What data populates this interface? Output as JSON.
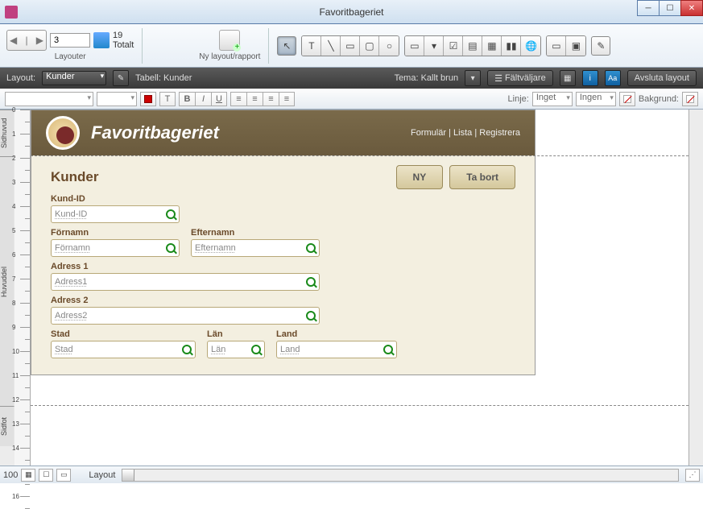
{
  "window": {
    "title": "Favoritbageriet"
  },
  "toolbar": {
    "current_record": "3",
    "total_count": "19",
    "total_label": "Totalt",
    "layouter_label": "Layouter",
    "new_layout_label": "Ny layout/rapport"
  },
  "darkbar": {
    "layout_label": "Layout:",
    "layout_value": "Kunder",
    "table_label": "Tabell:",
    "table_value": "Kunder",
    "tema_label": "Tema:",
    "tema_value": "Kallt brun",
    "faltvaljare": "Fältväljare",
    "exit": "Avsluta layout"
  },
  "fmtbar": {
    "linje_label": "Linje:",
    "linje_value": "Inget",
    "linje_style": "Ingen",
    "bakgrund_label": "Bakgrund:"
  },
  "ruler_unit": "cm",
  "form": {
    "title": "Favoritbageriet",
    "nav": {
      "formular": "Formulär",
      "lista": "Lista",
      "registrera": "Registrera"
    },
    "section": "Kunder",
    "btn_new": "NY",
    "btn_delete": "Ta bort",
    "fields": {
      "kundid": {
        "label": "Kund-ID",
        "ph": "Kund-ID"
      },
      "fornamn": {
        "label": "Förnamn",
        "ph": "Förnamn"
      },
      "efternamn": {
        "label": "Efternamn",
        "ph": "Efternamn"
      },
      "adress1": {
        "label": "Adress 1",
        "ph": "Adress1"
      },
      "adress2": {
        "label": "Adress 2",
        "ph": "Adress2"
      },
      "stad": {
        "label": "Stad",
        "ph": "Stad"
      },
      "lan": {
        "label": "Län",
        "ph": "Län"
      },
      "land": {
        "label": "Land",
        "ph": "Land"
      }
    }
  },
  "sections": {
    "sidhuvud": "Sidhuvud",
    "huvuddel": "Huvuddel",
    "sidfot": "Sidfot"
  },
  "status": {
    "zoom": "100",
    "mode": "Layout"
  }
}
